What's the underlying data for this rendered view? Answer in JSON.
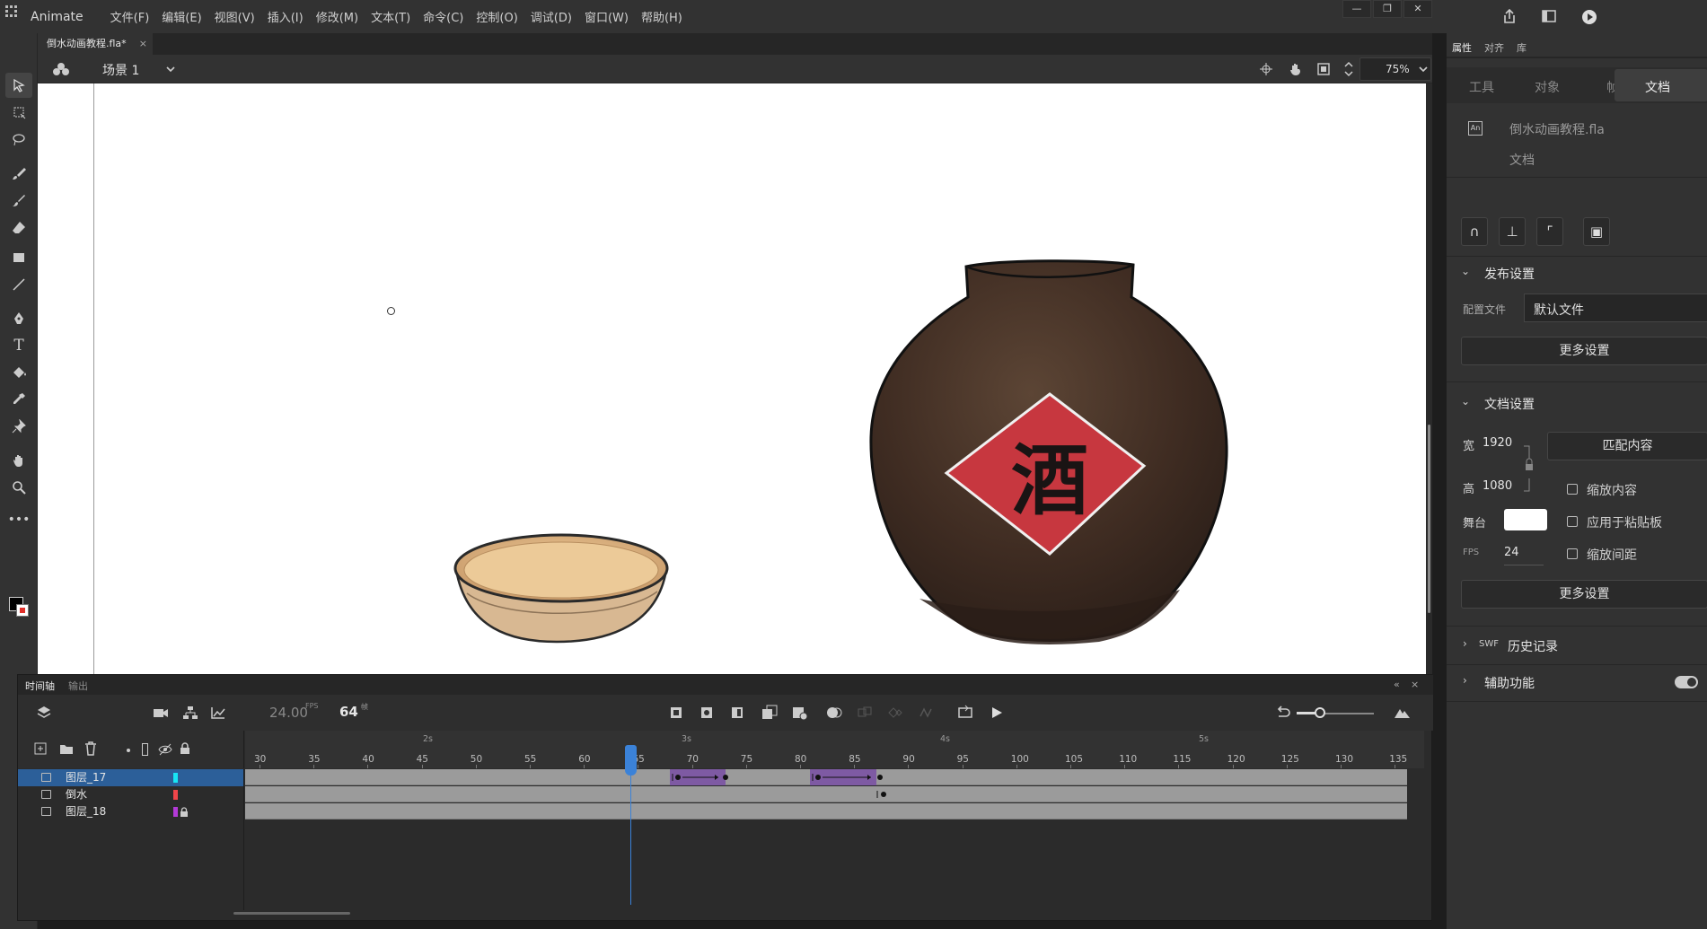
{
  "app": {
    "name": "Animate",
    "menus": [
      "文件(F)",
      "编辑(E)",
      "视图(V)",
      "插入(I)",
      "修改(M)",
      "文本(T)",
      "命令(C)",
      "控制(O)",
      "调试(D)",
      "窗口(W)",
      "帮助(H)"
    ]
  },
  "document": {
    "tab_label": "倒水动画教程.fla*",
    "close_glyph": "×"
  },
  "scene": {
    "label": "场景 1",
    "zoom": "75%"
  },
  "stage_art": {
    "jar_label": "酒"
  },
  "timeline": {
    "tabs": [
      "时间轴",
      "输出"
    ],
    "fps": "24.00",
    "fps_unit": "FPS",
    "current_frame": "64",
    "frame_unit": "帧",
    "ruler_ticks": [
      "30",
      "35",
      "40",
      "45",
      "50",
      "55",
      "60",
      "65",
      "70",
      "75",
      "80",
      "85",
      "90",
      "95",
      "100",
      "105",
      "110",
      "115",
      "120",
      "125",
      "130",
      "135"
    ],
    "second_marks": [
      "2s",
      "3s",
      "4s",
      "5s"
    ],
    "layers": [
      {
        "name": "图层_17",
        "color": "#18e5f5",
        "selected": true,
        "locked": false
      },
      {
        "name": "倒水",
        "color": "#f0454a",
        "selected": false,
        "locked": false
      },
      {
        "name": "图层_18",
        "color": "#b33ad8",
        "selected": false,
        "locked": true
      }
    ]
  },
  "properties": {
    "tabs": [
      "属性",
      "对齐",
      "库"
    ],
    "subtabs": [
      "工具",
      "对象",
      "帧",
      "文档"
    ],
    "file_name": "倒水动画教程.fla",
    "file_type": "文档",
    "publish": {
      "title": "发布设置",
      "profile_label": "配置文件",
      "profile_value": "默认文件",
      "more": "更多设置"
    },
    "doc_settings": {
      "title": "文档设置",
      "width_label": "宽",
      "width": "1920",
      "height_label": "高",
      "height": "1080",
      "match_button": "匹配内容",
      "scale_content": "缩放内容",
      "stage_label": "舞台",
      "apply_pasteboard": "应用于粘贴板",
      "fps_label": "FPS",
      "fps": "24",
      "scale_spacing": "缩放间距",
      "more": "更多设置",
      "stage_color": "#ffffff"
    },
    "swf_history": {
      "prefix": "SWF",
      "title": "历史记录"
    },
    "accessibility": "辅助功能"
  }
}
